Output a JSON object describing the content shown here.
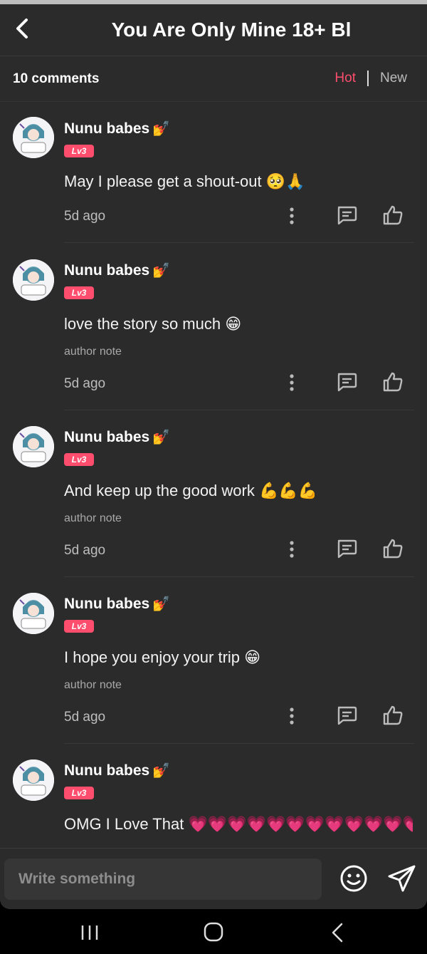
{
  "header": {
    "title": "You Are Only Mine 18+ Bl"
  },
  "subbar": {
    "count": "10 comments",
    "sort_hot": "Hot",
    "sort_new": "New"
  },
  "colors": {
    "accent": "#ff4d6d",
    "background": "#2b2b2b"
  },
  "comments": [
    {
      "username": "Nunu babes",
      "badge_emoji": "💅",
      "level": "Lv3",
      "text": "May I please get a shout-out 🥺🙏",
      "author_note": "",
      "time": "5d ago"
    },
    {
      "username": "Nunu babes",
      "badge_emoji": "💅",
      "level": "Lv3",
      "text": "love the story so much 😁",
      "author_note": "author note",
      "time": "5d ago"
    },
    {
      "username": "Nunu babes",
      "badge_emoji": "💅",
      "level": "Lv3",
      "text": "And keep up the good work 💪💪💪",
      "author_note": "author note",
      "time": "5d ago"
    },
    {
      "username": "Nunu babes",
      "badge_emoji": "💅",
      "level": "Lv3",
      "text": "I hope you enjoy your trip 😁",
      "author_note": "author note",
      "time": "5d ago"
    },
    {
      "username": "Nunu babes",
      "badge_emoji": "💅",
      "level": "Lv3",
      "text": "OMG I Love That 💗💗💗💗💗💗💗💗💗💗💗💗",
      "author_note": "",
      "time": ""
    }
  ],
  "input": {
    "placeholder": "Write something"
  },
  "icons": {
    "back": "chevron-left-icon",
    "more": "more-vertical-icon",
    "reply": "comment-icon",
    "like": "thumbs-up-icon",
    "emoji": "smiley-icon",
    "send": "send-icon"
  }
}
